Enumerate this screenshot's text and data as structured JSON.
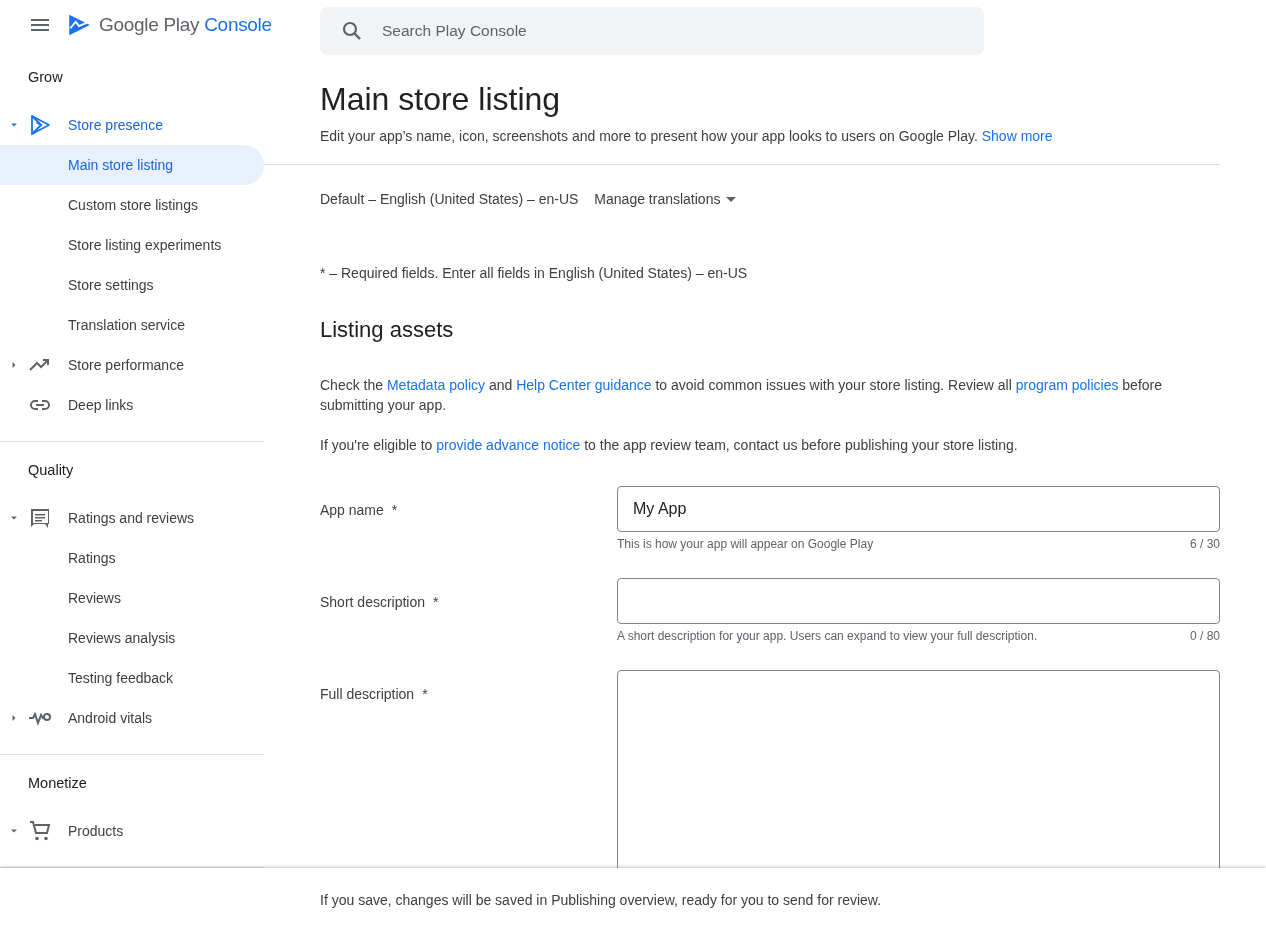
{
  "header": {
    "brand_primary": "Google Play",
    "brand_secondary": "Console"
  },
  "search": {
    "placeholder": "Search Play Console"
  },
  "sidebar": {
    "sections": [
      {
        "title": "Grow",
        "items": [
          {
            "label": "Store presence",
            "kind": "group",
            "expanded": true,
            "selected": false,
            "children": [
              {
                "label": "Main store listing",
                "selected": true
              },
              {
                "label": "Custom store listings",
                "selected": false
              },
              {
                "label": "Store listing experiments",
                "selected": false
              },
              {
                "label": "Store settings",
                "selected": false
              },
              {
                "label": "Translation service",
                "selected": false
              }
            ]
          },
          {
            "label": "Store performance",
            "kind": "group",
            "expanded": false,
            "selected": false
          },
          {
            "label": "Deep links",
            "kind": "link",
            "selected": false
          }
        ]
      },
      {
        "title": "Quality",
        "items": [
          {
            "label": "Ratings and reviews",
            "kind": "group",
            "expanded": true,
            "selected": false,
            "children": [
              {
                "label": "Ratings",
                "selected": false
              },
              {
                "label": "Reviews",
                "selected": false
              },
              {
                "label": "Reviews analysis",
                "selected": false
              },
              {
                "label": "Testing feedback",
                "selected": false
              }
            ]
          },
          {
            "label": "Android vitals",
            "kind": "group",
            "expanded": false,
            "selected": false
          }
        ]
      },
      {
        "title": "Monetize",
        "items": [
          {
            "label": "Products",
            "kind": "group",
            "expanded": true,
            "selected": false
          }
        ]
      }
    ]
  },
  "page": {
    "title": "Main store listing",
    "subtitle": "Edit your app’s name, icon, screenshots and more to present how your app looks to users on Google Play.",
    "show_more": "Show more",
    "language": "Default – English (United States) – en-US",
    "manage_translations": "Manage translations",
    "required_note": "* – Required fields. Enter all fields in English (United States) – en-US",
    "section_title": "Listing assets",
    "paragraphs": [
      [
        {
          "text": "Check the "
        },
        {
          "text": "Metadata policy",
          "link": true
        },
        {
          "text": " and "
        },
        {
          "text": "Help Center guidance",
          "link": true
        },
        {
          "text": " to avoid common issues with your store listing. Review all "
        },
        {
          "text": "program policies",
          "link": true
        },
        {
          "text": " before submitting your app."
        }
      ],
      [
        {
          "text": "If you're eligible to "
        },
        {
          "text": "provide advance notice",
          "link": true
        },
        {
          "text": " to the app review team, contact us before publishing your store listing."
        }
      ]
    ],
    "fields": [
      {
        "label": "App name",
        "mark": "*",
        "kind": "input",
        "value": "My App",
        "helper": "This is how your app will appear on Google Play",
        "counter": "6 / 30"
      },
      {
        "label": "Short description",
        "mark": "*",
        "kind": "input",
        "helper": "A short description for your app. Users can expand to view your full description.",
        "counter": "0 / 80"
      },
      {
        "label": "Full description",
        "mark": "*",
        "kind": "textarea"
      }
    ]
  },
  "footer": {
    "text": "If you save, changes will be saved in Publishing overview, ready for you to send for review."
  }
}
